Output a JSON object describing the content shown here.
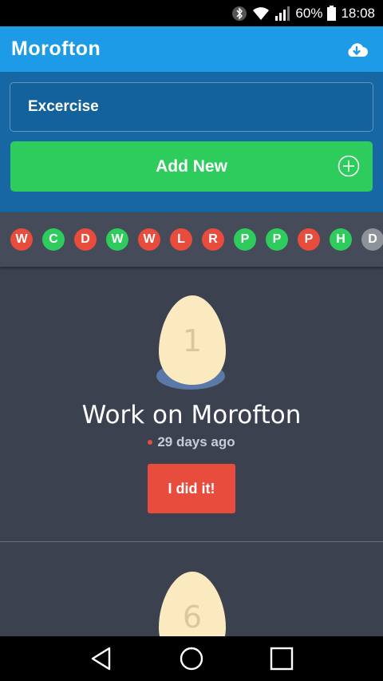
{
  "status_bar": {
    "battery": "60%",
    "time": "18:08"
  },
  "app": {
    "title": "Morofton"
  },
  "form": {
    "input_value": "Excercise",
    "add_button_label": "Add New"
  },
  "chips": [
    {
      "letter": "W",
      "color": "#e74c3c"
    },
    {
      "letter": "C",
      "color": "#2ecc5c"
    },
    {
      "letter": "D",
      "color": "#e74c3c"
    },
    {
      "letter": "W",
      "color": "#2ecc5c"
    },
    {
      "letter": "W",
      "color": "#e74c3c"
    },
    {
      "letter": "L",
      "color": "#e74c3c"
    },
    {
      "letter": "R",
      "color": "#e74c3c"
    },
    {
      "letter": "P",
      "color": "#2ecc5c"
    },
    {
      "letter": "P",
      "color": "#2ecc5c"
    },
    {
      "letter": "P",
      "color": "#e74c3c"
    },
    {
      "letter": "H",
      "color": "#2ecc5c"
    },
    {
      "letter": "D",
      "color": "#8e9299"
    }
  ],
  "habits": [
    {
      "streak": "1",
      "title": "Work on Morofton",
      "last_done": "29 days ago",
      "button_label": "I did it!"
    },
    {
      "streak": "6"
    }
  ],
  "colors": {
    "accent_blue": "#1e9be6",
    "green": "#2ecc5c",
    "red": "#e74c3c",
    "egg": "#fbeac0"
  }
}
